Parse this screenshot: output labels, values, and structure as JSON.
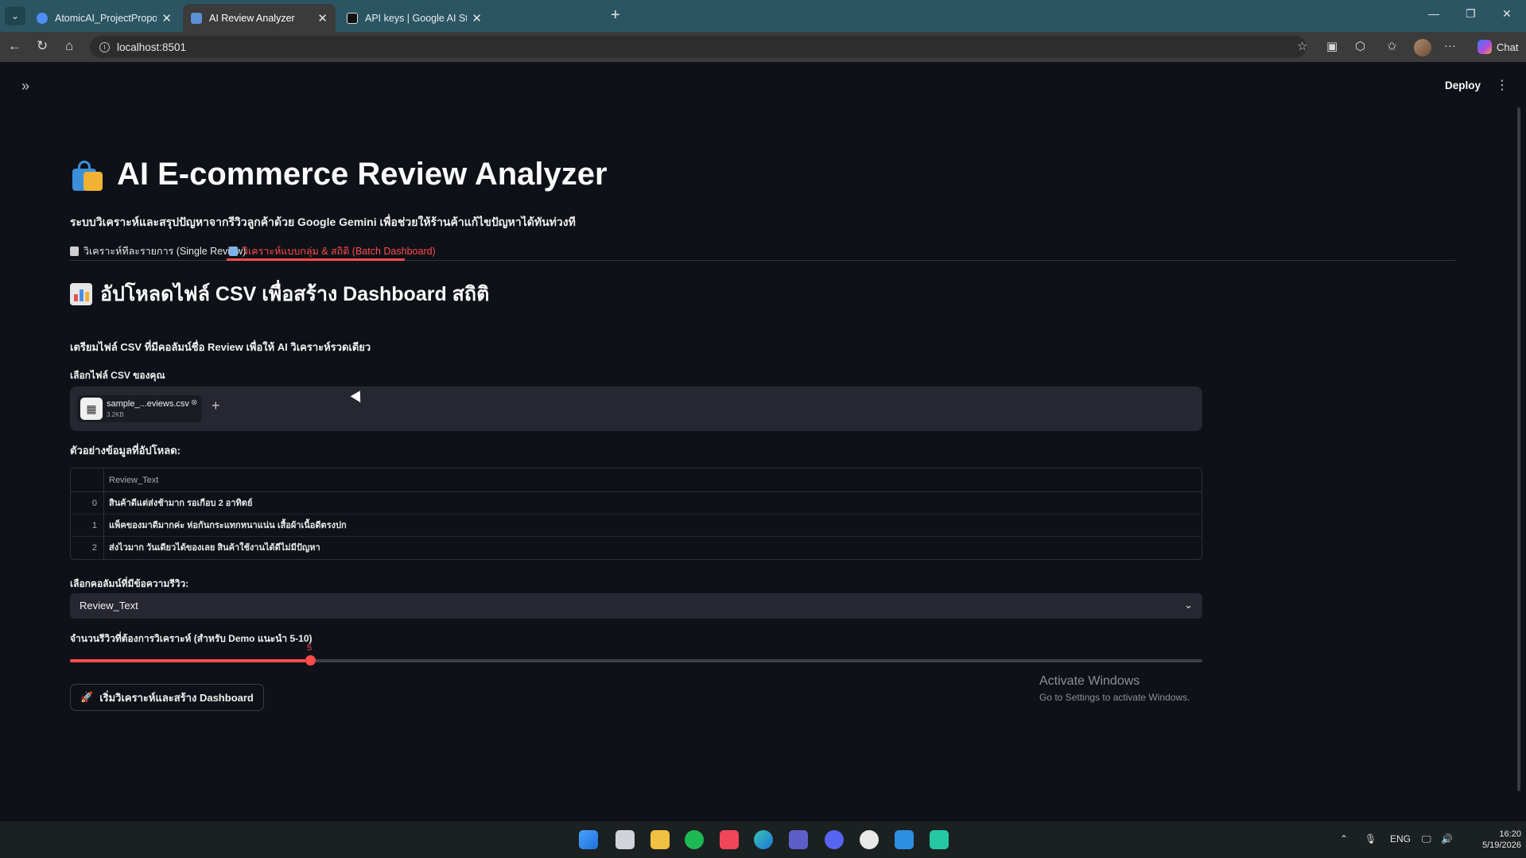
{
  "browser": {
    "tabs": [
      {
        "title": "AtomicAI_ProjectProposal - พิจาร",
        "active": false
      },
      {
        "title": "AI Review Analyzer",
        "active": true
      },
      {
        "title": "API keys | Google AI Studio",
        "active": false
      }
    ],
    "url": "localhost:8501",
    "chat_label": "Chat"
  },
  "app": {
    "deploy_label": "Deploy",
    "title": "AI E-commerce Review Analyzer",
    "subtitle": "ระบบวิเคราะห์และสรุปปัญหาจากรีวิวลูกค้าด้วย Google Gemini เพื่อช่วยให้ร้านค้าแก้ไขปัญหาได้ทันท่วงที",
    "tabs": [
      {
        "label": "วิเคราะห์ทีละรายการ (Single Review)",
        "active": false
      },
      {
        "label": "วิเคราะห์แบบกลุ่ม & สถิติ (Batch Dashboard)",
        "active": true
      }
    ],
    "section_title": "อัปโหลดไฟล์ CSV เพื่อสร้าง Dashboard สถิติ",
    "section_desc": "เตรียมไฟล์ CSV ที่มีคอลัมน์ชื่อ Review เพื่อให้ AI วิเคราะห์รวดเดียว",
    "uploader_label": "เลือกไฟล์ CSV ของคุณ",
    "uploaded_file": {
      "name": "sample_...eviews.csv",
      "size": "3.2KB"
    },
    "preview_label": "ตัวอย่างข้อมูลที่อัปโหลด:",
    "table": {
      "column": "Review_Text",
      "rows": [
        {
          "index": "0",
          "text": "สินค้าดีแต่ส่งช้ามาก รอเกือบ 2 อาทิตย์"
        },
        {
          "index": "1",
          "text": "แพ็คของมาดีมากค่ะ ห่อกันกระแทกหนาแน่น เสื้อผ้าเนื้อดีตรงปก"
        },
        {
          "index": "2",
          "text": "ส่งไวมาก วันเดียวได้ของเลย สินค้าใช้งานได้ดีไม่มีปัญหา"
        }
      ]
    },
    "column_select_label": "เลือกคอลัมน์ที่มีข้อความรีวิว:",
    "column_select_value": "Review_Text",
    "slider_label": "จำนวนรีวิวที่ต้องการวิเคราะห์ (สำหรับ Demo แนะนำ 5-10)",
    "slider": {
      "value": "5",
      "fraction": 0.212
    },
    "run_button": "เริ่มวิเคราะห์และสร้าง Dashboard",
    "accent_color": "#ff4b4b"
  },
  "watermark": {
    "line1": "Activate Windows",
    "line2": "Go to Settings to activate Windows."
  },
  "taskbar": {
    "language": "ENG",
    "time": "16:20",
    "date": "5/19/2026"
  }
}
